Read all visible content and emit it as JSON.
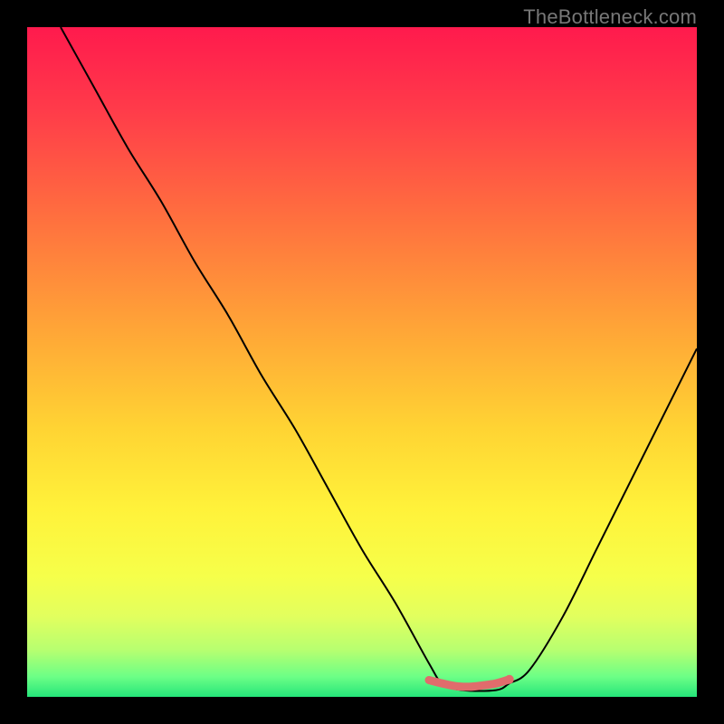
{
  "watermark": {
    "text": "TheBottleneck.com"
  },
  "chart_data": {
    "type": "line",
    "title": "",
    "xlabel": "",
    "ylabel": "",
    "xlim": [
      0,
      100
    ],
    "ylim": [
      0,
      100
    ],
    "grid": false,
    "legend": false,
    "series": [
      {
        "name": "bottleneck-curve",
        "color": "#000000",
        "x": [
          5,
          10,
          15,
          20,
          25,
          30,
          35,
          40,
          45,
          50,
          55,
          60,
          62,
          65,
          70,
          72,
          75,
          80,
          85,
          90,
          95,
          100
        ],
        "values": [
          100,
          91,
          82,
          74,
          65,
          57,
          48,
          40,
          31,
          22,
          14,
          5,
          2,
          1,
          1,
          2,
          4,
          12,
          22,
          32,
          42,
          52
        ]
      },
      {
        "name": "valley-marker",
        "color": "#e06c6c",
        "x": [
          60,
          62,
          64,
          66,
          68,
          70,
          72
        ],
        "values": [
          2.5,
          2.0,
          1.6,
          1.5,
          1.7,
          2.0,
          2.6
        ]
      }
    ],
    "annotations": []
  },
  "gradient_stops": [
    {
      "offset": 0.0,
      "color": "#ff1a4d"
    },
    {
      "offset": 0.12,
      "color": "#ff3a4a"
    },
    {
      "offset": 0.28,
      "color": "#ff6e3f"
    },
    {
      "offset": 0.45,
      "color": "#ffa537"
    },
    {
      "offset": 0.6,
      "color": "#ffd433"
    },
    {
      "offset": 0.72,
      "color": "#fff23a"
    },
    {
      "offset": 0.82,
      "color": "#f6ff4a"
    },
    {
      "offset": 0.88,
      "color": "#e2ff5e"
    },
    {
      "offset": 0.93,
      "color": "#b7ff70"
    },
    {
      "offset": 0.97,
      "color": "#6cff86"
    },
    {
      "offset": 1.0,
      "color": "#25e57a"
    }
  ],
  "marker": {
    "color": "#e06c6c",
    "end_dot_radius_px": 5
  }
}
